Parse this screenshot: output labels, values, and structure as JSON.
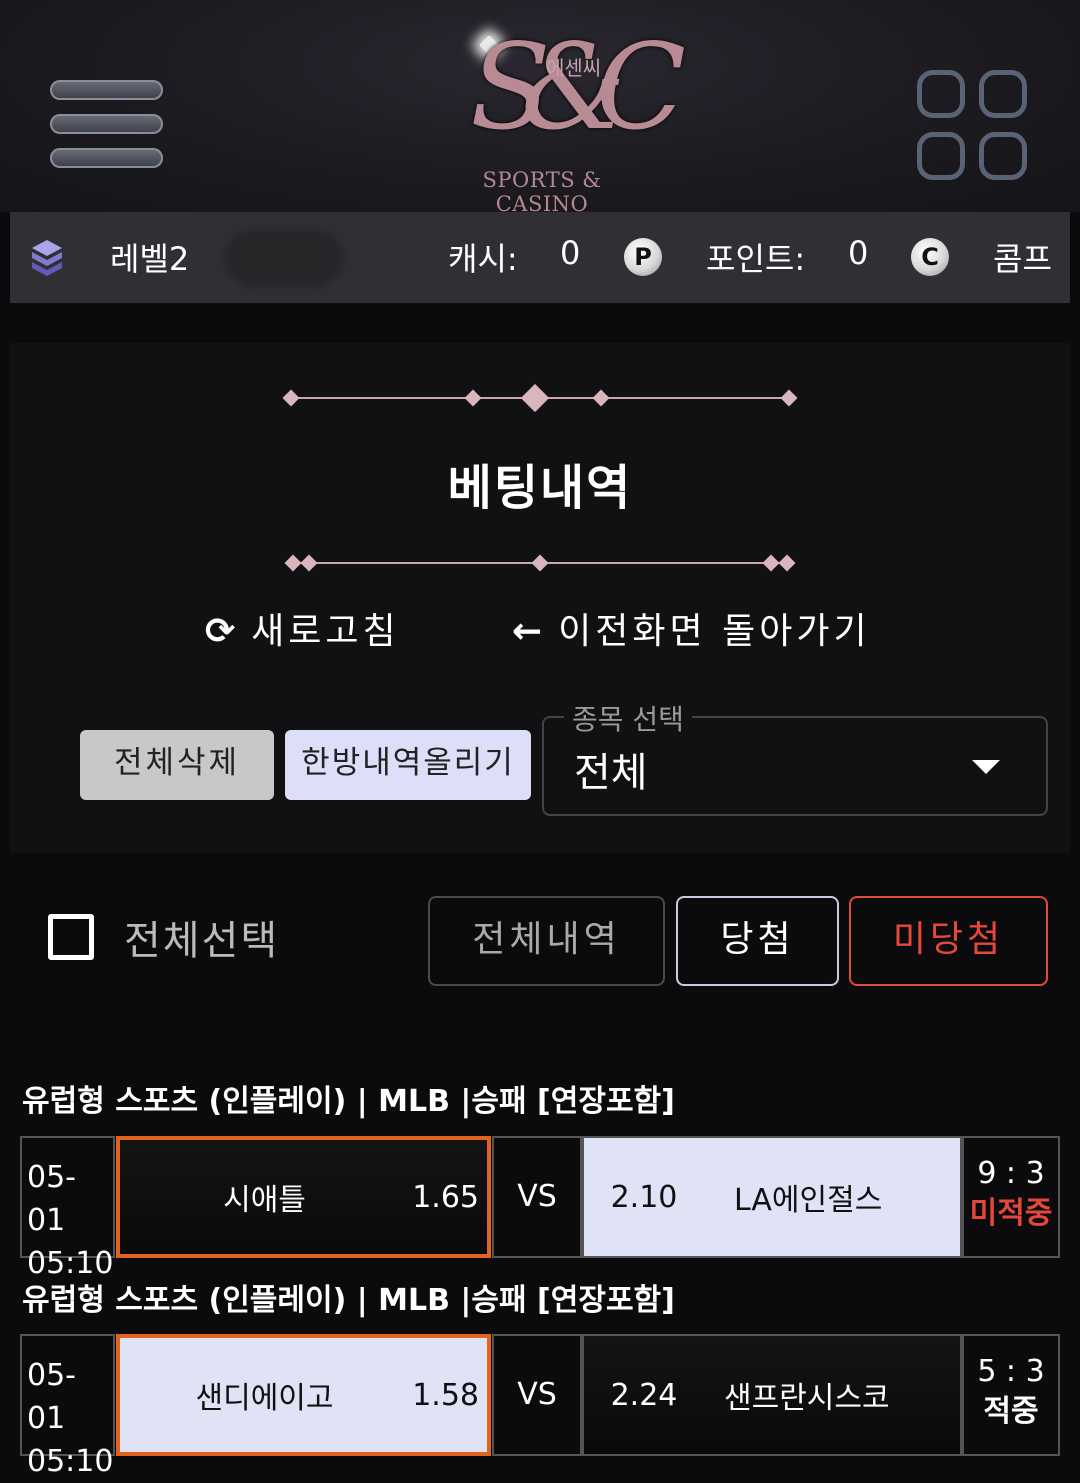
{
  "header": {
    "logo_mono": "S&C",
    "logo_korean": "에센씨",
    "logo_brand": "SPORTS & CASINO",
    "menu_icon": "hamburger-icon",
    "apps_icon": "grid-icon"
  },
  "status": {
    "level": "레벨2",
    "cash_label": "캐시:",
    "cash_value": "0",
    "point_coin": "P",
    "point_label": "포인트:",
    "point_value": "0",
    "comp_coin": "C",
    "comp_label": "콤프"
  },
  "page": {
    "title": "베팅내역",
    "refresh_icon": "⟳",
    "refresh_label": "새로고침",
    "back_icon": "←",
    "back_label": "이전화면 돌아가기"
  },
  "controls": {
    "delete_all": "전체삭제",
    "upload_combo": "한방내역올리기",
    "sport_select_legend": "종목 선택",
    "sport_select_value": "전체"
  },
  "filters": {
    "select_all_label": "전체선택",
    "tabs": [
      "전체내역",
      "당첨",
      "미당첨"
    ]
  },
  "bets": [
    {
      "title": "유럽형 스포츠 (인플레이) | MLB |승패 [연장포함]",
      "date": "05-01",
      "time": "05:10",
      "home": "시애틀",
      "home_odds": "1.65",
      "vs": "VS",
      "away_odds": "2.10",
      "away": "LA에인절스",
      "score": "9 : 3",
      "result": "미적중",
      "result_color": "#e5473a",
      "selected": "home"
    },
    {
      "title": "유럽형 스포츠 (인플레이) | MLB |승패 [연장포함]",
      "date": "05-01",
      "time": "05:10",
      "home": "샌디에이고",
      "home_odds": "1.58",
      "vs": "VS",
      "away_odds": "2.24",
      "away": "샌프란시스코",
      "score": "5 : 3",
      "result": "적중",
      "result_color": "#ffffff",
      "selected": "home"
    }
  ]
}
